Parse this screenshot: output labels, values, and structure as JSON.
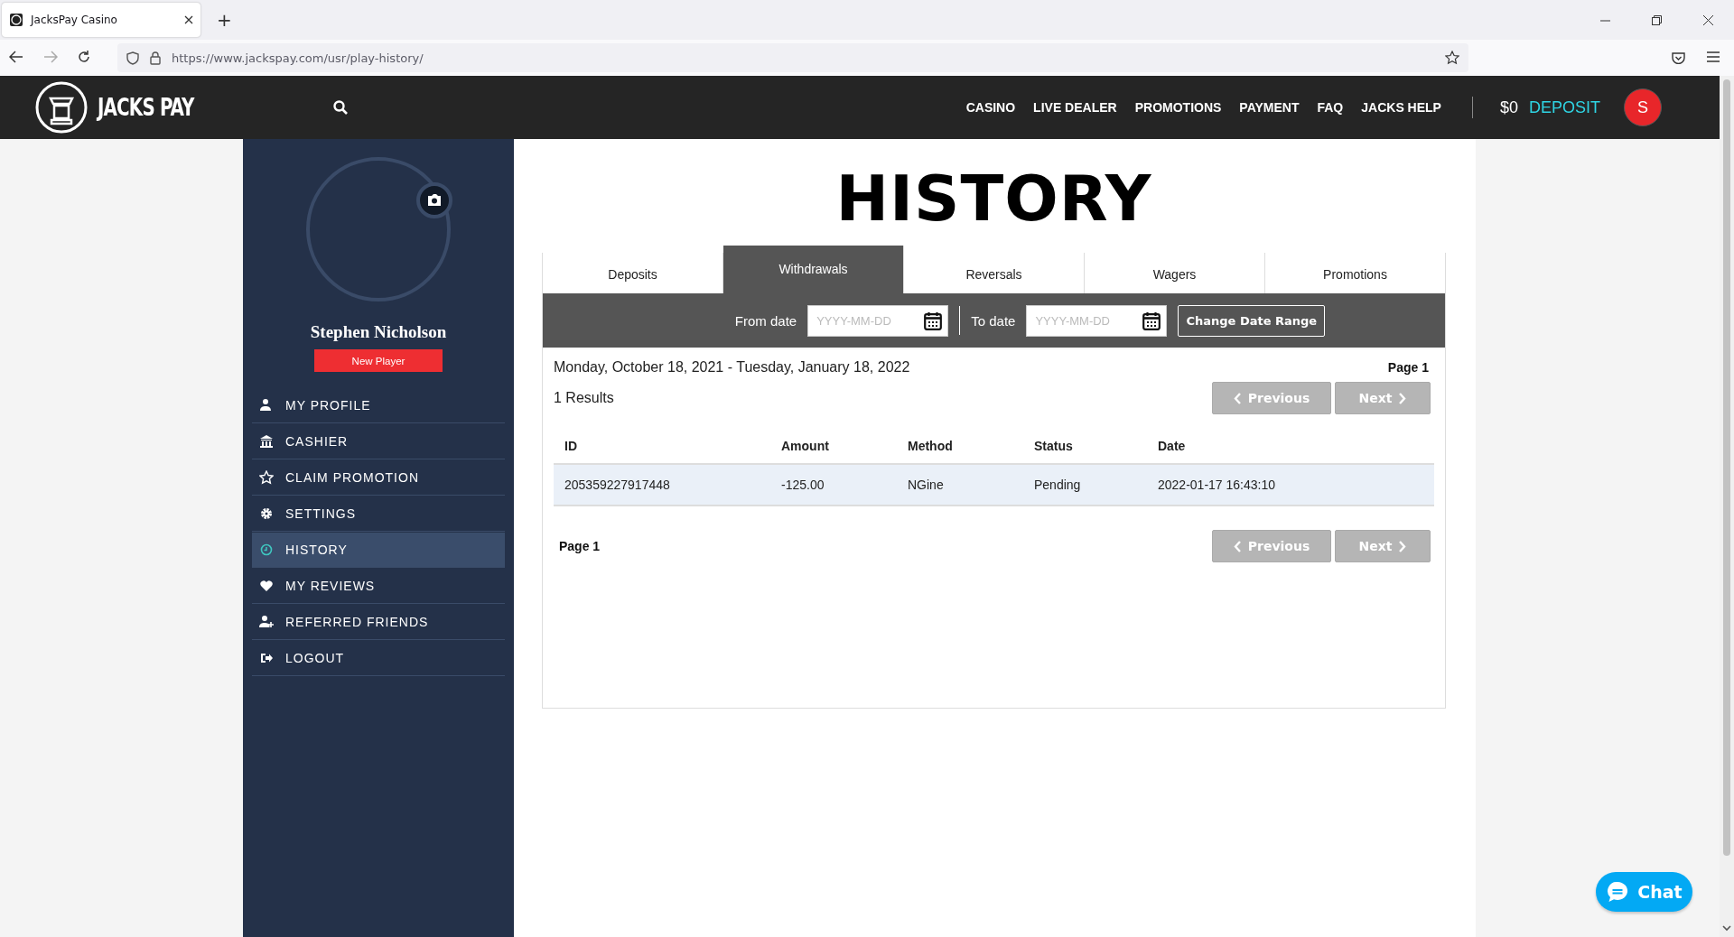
{
  "browser": {
    "tab_title": "JacksPay Casino",
    "new_tab": "+",
    "url": "https://www.jackspay.com/usr/play-history/"
  },
  "header": {
    "logo": "JACKS PAY",
    "nav": [
      "CASINO",
      "LIVE DEALER",
      "PROMOTIONS",
      "PAYMENT",
      "FAQ",
      "JACKS HELP"
    ],
    "balance": "$0",
    "deposit": "DEPOSIT",
    "avatar_initial": "S"
  },
  "sidebar": {
    "name": "Stephen Nicholson",
    "badge": "New Player",
    "items": [
      {
        "label": "MY PROFILE",
        "selected": false
      },
      {
        "label": "CASHIER",
        "selected": false
      },
      {
        "label": "CLAIM PROMOTION",
        "selected": false
      },
      {
        "label": "SETTINGS",
        "selected": false
      },
      {
        "label": "HISTORY",
        "selected": true
      },
      {
        "label": "MY REVIEWS",
        "selected": false
      },
      {
        "label": "REFERRED FRIENDS",
        "selected": false
      },
      {
        "label": "LOGOUT",
        "selected": false
      }
    ]
  },
  "page_title": "HISTORY",
  "tabs": [
    {
      "label": "Deposits",
      "selected": false
    },
    {
      "label": "Withdrawals",
      "selected": true
    },
    {
      "label": "Reversals",
      "selected": false
    },
    {
      "label": "Wagers",
      "selected": false
    },
    {
      "label": "Promotions",
      "selected": false
    }
  ],
  "filter": {
    "from_label": "From date",
    "from_placeholder": "YYYY-MM-DD",
    "to_label": "To date",
    "to_placeholder": "YYYY-MM-DD",
    "button": "Change Date Range"
  },
  "range": "Monday, October 18, 2021 - Tuesday, January 18, 2022",
  "page_label_top": "Page 1",
  "results": "1 Results",
  "pager_top": [
    {
      "label": "Previous",
      "disabled": true
    },
    {
      "label": "Next",
      "disabled": true
    }
  ],
  "table": {
    "columns": [
      "ID",
      "Amount",
      "Method",
      "Status",
      "Date"
    ],
    "rows": [
      [
        "205359227917448",
        "-125.00",
        "NGine",
        "Pending",
        "2022-01-17 16:43:10"
      ]
    ]
  },
  "page_label_bottom": "Page 1",
  "pager_bottom": [
    {
      "label": "Previous",
      "disabled": true
    },
    {
      "label": "Next",
      "disabled": true
    }
  ],
  "chat": "Chat"
}
